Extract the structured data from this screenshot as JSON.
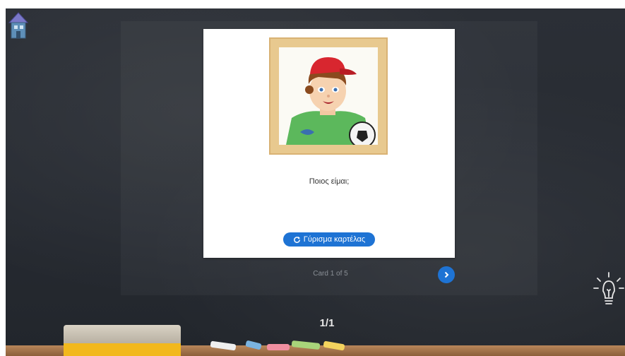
{
  "card": {
    "question": "Ποιος είμαι;",
    "flip_label": "Γύρισμα καρτέλας"
  },
  "navigation": {
    "card_counter": "Card 1 of 5",
    "page_indicator": "1/1"
  },
  "icons": {
    "home": "house-icon",
    "flip": "refresh-icon",
    "next": "chevron-right-icon",
    "hint": "lightbulb-icon"
  },
  "colors": {
    "accent": "#1e73d4",
    "board": "#262a31",
    "card": "#ffffff"
  }
}
